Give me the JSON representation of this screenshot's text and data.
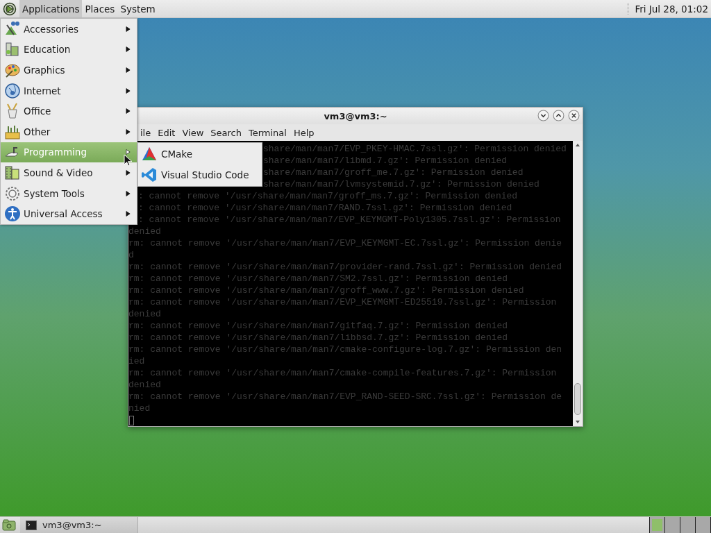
{
  "top_panel": {
    "menus": [
      {
        "label": "Applications",
        "selected": true
      },
      {
        "label": "Places",
        "selected": false
      },
      {
        "label": "System",
        "selected": false
      }
    ],
    "clock": "Fri Jul 28, 01:02"
  },
  "applications_menu": {
    "items": [
      {
        "label": "Accessories",
        "selected": false
      },
      {
        "label": "Education",
        "selected": false
      },
      {
        "label": "Graphics",
        "selected": false
      },
      {
        "label": "Internet",
        "selected": false
      },
      {
        "label": "Office",
        "selected": false
      },
      {
        "label": "Other",
        "selected": false
      },
      {
        "label": "Programming",
        "selected": true
      },
      {
        "label": "Sound & Video",
        "selected": false
      },
      {
        "label": "System Tools",
        "selected": false
      },
      {
        "label": "Universal Access",
        "selected": false
      }
    ]
  },
  "submenu": {
    "items": [
      {
        "label": "CMake",
        "kind": "cmake"
      },
      {
        "label": "Visual Studio Code",
        "kind": "vscode"
      }
    ]
  },
  "terminal": {
    "title": "vm3@vm3:~",
    "menu": [
      "ile",
      "Edit",
      "View",
      "Search",
      "Terminal",
      "Help"
    ],
    "lines": [
      {
        "kind": "after-submenu",
        "text": "share/man/man7/EVP_PKEY-HMAC.7ssl.gz': Permission denied"
      },
      {
        "kind": "after-submenu",
        "text": "share/man/man7/libmd.7.gz': Permission denied"
      },
      {
        "kind": "after-submenu",
        "text": "share/man/man7/groff_me.7.gz': Permission denied"
      },
      {
        "kind": "after-submenu",
        "text": "share/man/man7/lvmsystemid.7.gz': Permission denied"
      },
      {
        "kind": "after-menu",
        "text": ": cannot remove '/usr/share/man/man7/groff_ms.7.gz': Permission denied"
      },
      {
        "kind": "after-menu",
        "text": ": cannot remove '/usr/share/man/man7/RAND.7ssl.gz': Permission denied"
      },
      {
        "kind": "after-menu",
        "text": ": cannot remove '/usr/share/man/man7/EVP_KEYMGMT-Poly1305.7ssl.gz': Permission"
      },
      {
        "kind": "full",
        "text": "denied"
      },
      {
        "kind": "full",
        "text": "rm: cannot remove '/usr/share/man/man7/EVP_KEYMGMT-EC.7ssl.gz': Permission denie"
      },
      {
        "kind": "full",
        "text": "d"
      },
      {
        "kind": "full",
        "text": "rm: cannot remove '/usr/share/man/man7/provider-rand.7ssl.gz': Permission denied"
      },
      {
        "kind": "full",
        "text": "rm: cannot remove '/usr/share/man/man7/SM2.7ssl.gz': Permission denied"
      },
      {
        "kind": "full",
        "text": "rm: cannot remove '/usr/share/man/man7/groff_www.7.gz': Permission denied"
      },
      {
        "kind": "full",
        "text": "rm: cannot remove '/usr/share/man/man7/EVP_KEYMGMT-ED25519.7ssl.gz': Permission"
      },
      {
        "kind": "full",
        "text": "denied"
      },
      {
        "kind": "full",
        "text": "rm: cannot remove '/usr/share/man/man7/gitfaq.7.gz': Permission denied"
      },
      {
        "kind": "full",
        "text": "rm: cannot remove '/usr/share/man/man7/libbsd.7.gz': Permission denied"
      },
      {
        "kind": "full",
        "text": "rm: cannot remove '/usr/share/man/man7/cmake-configure-log.7.gz': Permission den"
      },
      {
        "kind": "full",
        "text": "ied"
      },
      {
        "kind": "full",
        "text": "rm: cannot remove '/usr/share/man/man7/cmake-compile-features.7.gz': Permission"
      },
      {
        "kind": "full",
        "text": "denied"
      },
      {
        "kind": "full",
        "text": "rm: cannot remove '/usr/share/man/man7/EVP_RAND-SEED-SRC.7ssl.gz': Permission de"
      },
      {
        "kind": "full",
        "text": "nied"
      }
    ]
  },
  "taskbar": {
    "windows": [
      {
        "label": "vm3@vm3:~",
        "selected": false
      }
    ],
    "workspaces": [
      {
        "selected": true
      },
      {
        "selected": false
      },
      {
        "selected": false
      },
      {
        "selected": false
      }
    ]
  }
}
